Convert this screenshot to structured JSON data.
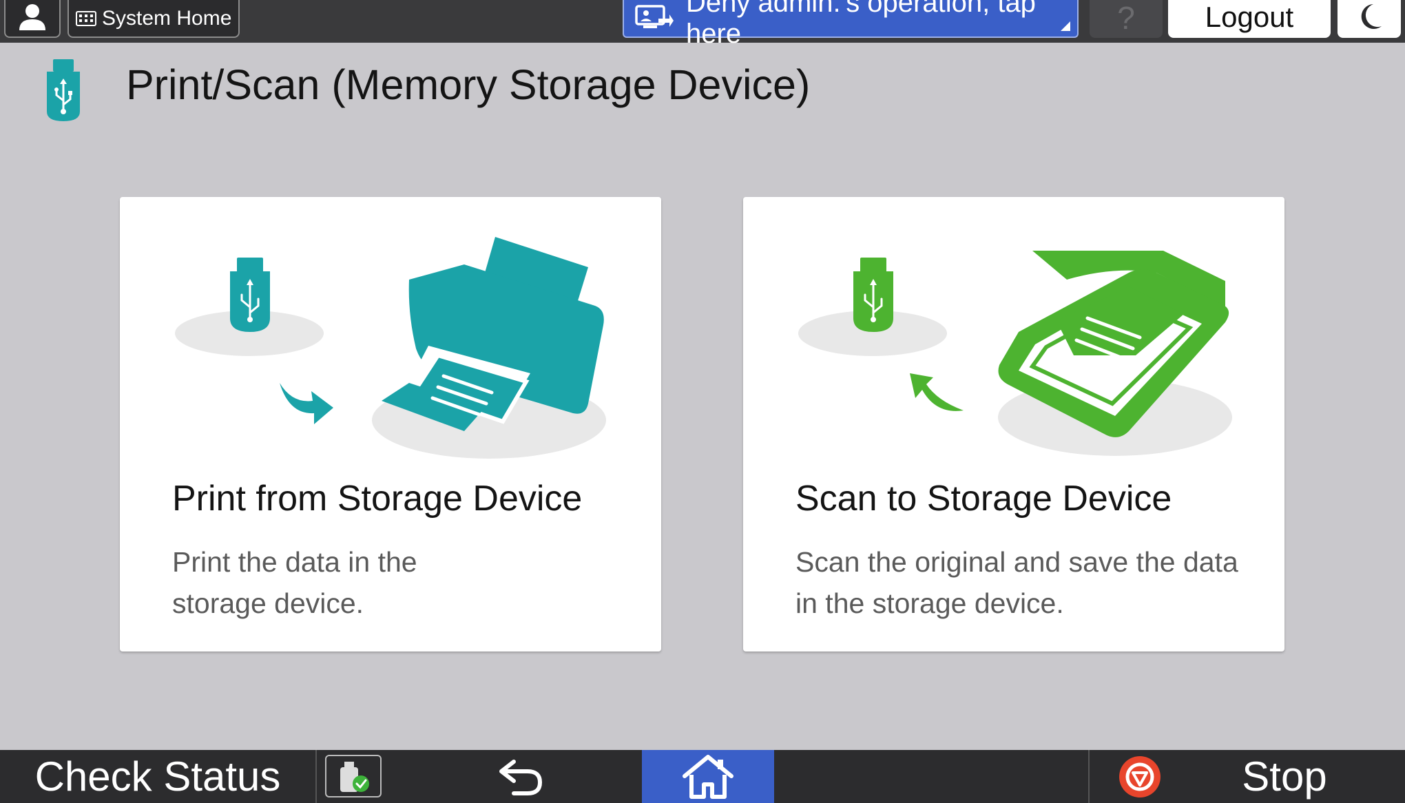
{
  "topbar": {
    "system_home_label": "System Home",
    "deny_label": "Deny admin.'s operation, tap here",
    "help_label": "?",
    "logout_label": "Logout"
  },
  "page": {
    "title": "Print/Scan (Memory Storage Device)"
  },
  "cards": [
    {
      "title": "Print from Storage Device",
      "desc_line1": "Print the data in the",
      "desc_line2": "storage device.",
      "accent": "#1ba3a8"
    },
    {
      "title": "Scan to Storage Device",
      "desc_line1": "Scan the original and save the data",
      "desc_line2": "in the storage device.",
      "accent": "#4db330"
    }
  ],
  "bottombar": {
    "check_status_label": "Check Status",
    "stop_label": "Stop"
  },
  "colors": {
    "topbar_bg": "#3a3a3c",
    "deny_blue": "#3a5fc8",
    "home_blue": "#3a5fc8",
    "stop_red": "#e8452c",
    "background": "#c9c8cc"
  },
  "icons": {
    "user": "user-icon",
    "system_home": "grid-icon",
    "deny": "remote-operation-icon",
    "sleep": "moon-icon",
    "usb": "usb-drive-icon",
    "storage_status": "storage-status-icon",
    "back": "back-arrow-icon",
    "home": "home-icon",
    "stop": "stop-icon"
  }
}
